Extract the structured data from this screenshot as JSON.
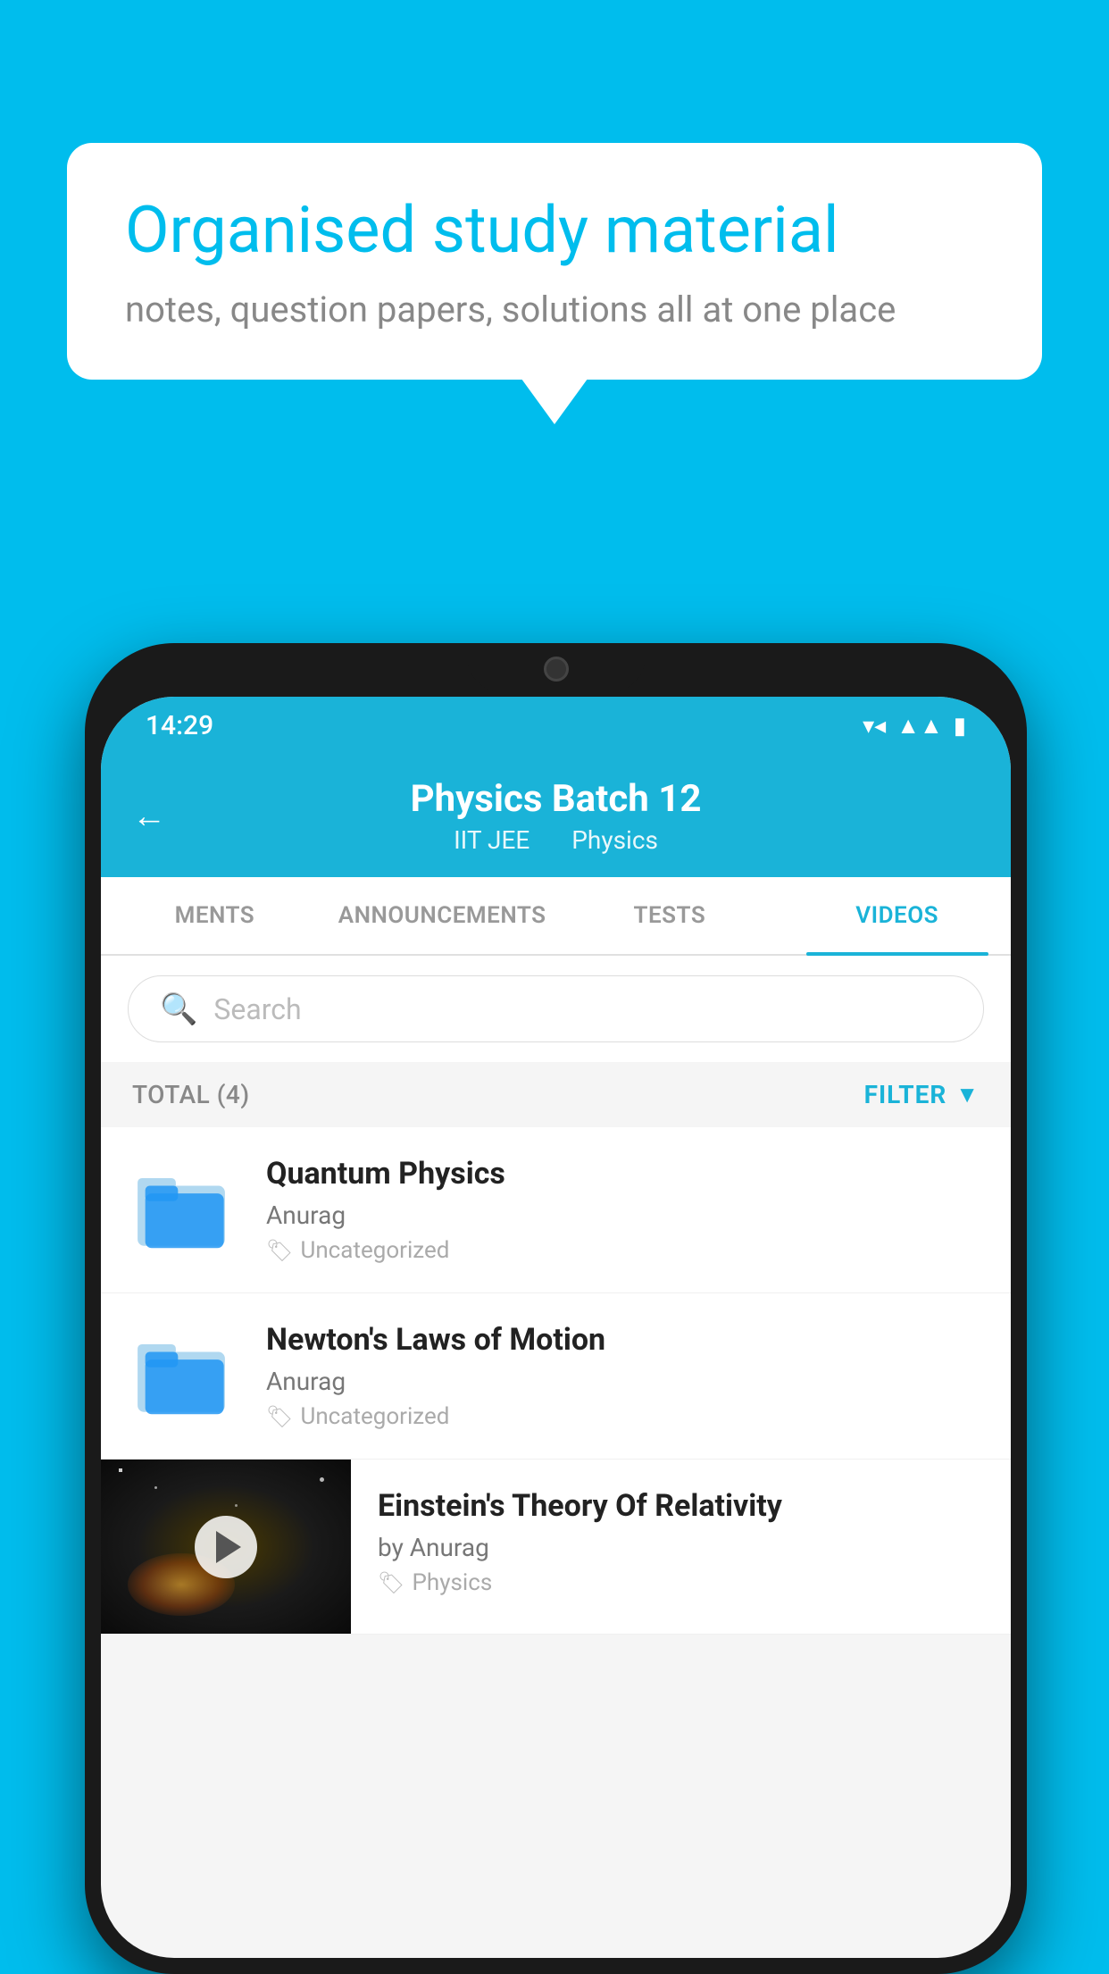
{
  "background_color": "#00BDED",
  "bubble": {
    "title": "Organised study material",
    "subtitle": "notes, question papers, solutions all at one place"
  },
  "status_bar": {
    "time": "14:29",
    "wifi": "▼▲",
    "battery": "■"
  },
  "header": {
    "back_label": "←",
    "title": "Physics Batch 12",
    "subtitle_part1": "IIT JEE",
    "subtitle_part2": "Physics"
  },
  "tabs": [
    {
      "label": "MENTS",
      "active": false
    },
    {
      "label": "ANNOUNCEMENTS",
      "active": false
    },
    {
      "label": "TESTS",
      "active": false
    },
    {
      "label": "VIDEOS",
      "active": true
    }
  ],
  "search": {
    "placeholder": "Search"
  },
  "filter_row": {
    "total_label": "TOTAL (4)",
    "filter_label": "FILTER"
  },
  "videos": [
    {
      "title": "Quantum Physics",
      "author": "Anurag",
      "tag": "Uncategorized",
      "has_thumbnail": false
    },
    {
      "title": "Newton's Laws of Motion",
      "author": "Anurag",
      "tag": "Uncategorized",
      "has_thumbnail": false
    },
    {
      "title": "Einstein's Theory Of Relativity",
      "author": "by Anurag",
      "tag": "Physics",
      "has_thumbnail": true
    }
  ]
}
